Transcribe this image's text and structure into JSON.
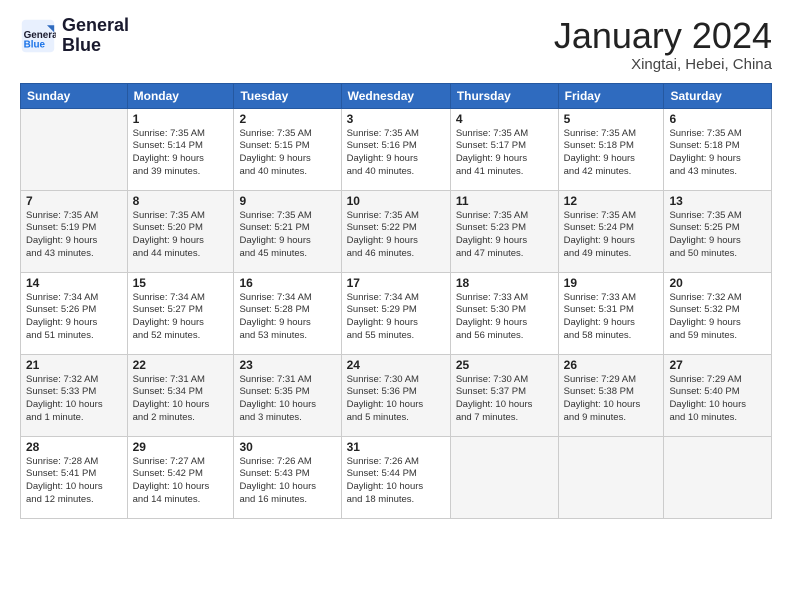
{
  "header": {
    "logo_line1": "General",
    "logo_line2": "Blue",
    "month": "January 2024",
    "location": "Xingtai, Hebei, China"
  },
  "days_of_week": [
    "Sunday",
    "Monday",
    "Tuesday",
    "Wednesday",
    "Thursday",
    "Friday",
    "Saturday"
  ],
  "weeks": [
    [
      {
        "date": "",
        "info": ""
      },
      {
        "date": "1",
        "info": "Sunrise: 7:35 AM\nSunset: 5:14 PM\nDaylight: 9 hours\nand 39 minutes."
      },
      {
        "date": "2",
        "info": "Sunrise: 7:35 AM\nSunset: 5:15 PM\nDaylight: 9 hours\nand 40 minutes."
      },
      {
        "date": "3",
        "info": "Sunrise: 7:35 AM\nSunset: 5:16 PM\nDaylight: 9 hours\nand 40 minutes."
      },
      {
        "date": "4",
        "info": "Sunrise: 7:35 AM\nSunset: 5:17 PM\nDaylight: 9 hours\nand 41 minutes."
      },
      {
        "date": "5",
        "info": "Sunrise: 7:35 AM\nSunset: 5:18 PM\nDaylight: 9 hours\nand 42 minutes."
      },
      {
        "date": "6",
        "info": "Sunrise: 7:35 AM\nSunset: 5:18 PM\nDaylight: 9 hours\nand 43 minutes."
      }
    ],
    [
      {
        "date": "7",
        "info": "Sunrise: 7:35 AM\nSunset: 5:19 PM\nDaylight: 9 hours\nand 43 minutes."
      },
      {
        "date": "8",
        "info": "Sunrise: 7:35 AM\nSunset: 5:20 PM\nDaylight: 9 hours\nand 44 minutes."
      },
      {
        "date": "9",
        "info": "Sunrise: 7:35 AM\nSunset: 5:21 PM\nDaylight: 9 hours\nand 45 minutes."
      },
      {
        "date": "10",
        "info": "Sunrise: 7:35 AM\nSunset: 5:22 PM\nDaylight: 9 hours\nand 46 minutes."
      },
      {
        "date": "11",
        "info": "Sunrise: 7:35 AM\nSunset: 5:23 PM\nDaylight: 9 hours\nand 47 minutes."
      },
      {
        "date": "12",
        "info": "Sunrise: 7:35 AM\nSunset: 5:24 PM\nDaylight: 9 hours\nand 49 minutes."
      },
      {
        "date": "13",
        "info": "Sunrise: 7:35 AM\nSunset: 5:25 PM\nDaylight: 9 hours\nand 50 minutes."
      }
    ],
    [
      {
        "date": "14",
        "info": "Sunrise: 7:34 AM\nSunset: 5:26 PM\nDaylight: 9 hours\nand 51 minutes."
      },
      {
        "date": "15",
        "info": "Sunrise: 7:34 AM\nSunset: 5:27 PM\nDaylight: 9 hours\nand 52 minutes."
      },
      {
        "date": "16",
        "info": "Sunrise: 7:34 AM\nSunset: 5:28 PM\nDaylight: 9 hours\nand 53 minutes."
      },
      {
        "date": "17",
        "info": "Sunrise: 7:34 AM\nSunset: 5:29 PM\nDaylight: 9 hours\nand 55 minutes."
      },
      {
        "date": "18",
        "info": "Sunrise: 7:33 AM\nSunset: 5:30 PM\nDaylight: 9 hours\nand 56 minutes."
      },
      {
        "date": "19",
        "info": "Sunrise: 7:33 AM\nSunset: 5:31 PM\nDaylight: 9 hours\nand 58 minutes."
      },
      {
        "date": "20",
        "info": "Sunrise: 7:32 AM\nSunset: 5:32 PM\nDaylight: 9 hours\nand 59 minutes."
      }
    ],
    [
      {
        "date": "21",
        "info": "Sunrise: 7:32 AM\nSunset: 5:33 PM\nDaylight: 10 hours\nand 1 minute."
      },
      {
        "date": "22",
        "info": "Sunrise: 7:31 AM\nSunset: 5:34 PM\nDaylight: 10 hours\nand 2 minutes."
      },
      {
        "date": "23",
        "info": "Sunrise: 7:31 AM\nSunset: 5:35 PM\nDaylight: 10 hours\nand 3 minutes."
      },
      {
        "date": "24",
        "info": "Sunrise: 7:30 AM\nSunset: 5:36 PM\nDaylight: 10 hours\nand 5 minutes."
      },
      {
        "date": "25",
        "info": "Sunrise: 7:30 AM\nSunset: 5:37 PM\nDaylight: 10 hours\nand 7 minutes."
      },
      {
        "date": "26",
        "info": "Sunrise: 7:29 AM\nSunset: 5:38 PM\nDaylight: 10 hours\nand 9 minutes."
      },
      {
        "date": "27",
        "info": "Sunrise: 7:29 AM\nSunset: 5:40 PM\nDaylight: 10 hours\nand 10 minutes."
      }
    ],
    [
      {
        "date": "28",
        "info": "Sunrise: 7:28 AM\nSunset: 5:41 PM\nDaylight: 10 hours\nand 12 minutes."
      },
      {
        "date": "29",
        "info": "Sunrise: 7:27 AM\nSunset: 5:42 PM\nDaylight: 10 hours\nand 14 minutes."
      },
      {
        "date": "30",
        "info": "Sunrise: 7:26 AM\nSunset: 5:43 PM\nDaylight: 10 hours\nand 16 minutes."
      },
      {
        "date": "31",
        "info": "Sunrise: 7:26 AM\nSunset: 5:44 PM\nDaylight: 10 hours\nand 18 minutes."
      },
      {
        "date": "",
        "info": ""
      },
      {
        "date": "",
        "info": ""
      },
      {
        "date": "",
        "info": ""
      }
    ]
  ]
}
